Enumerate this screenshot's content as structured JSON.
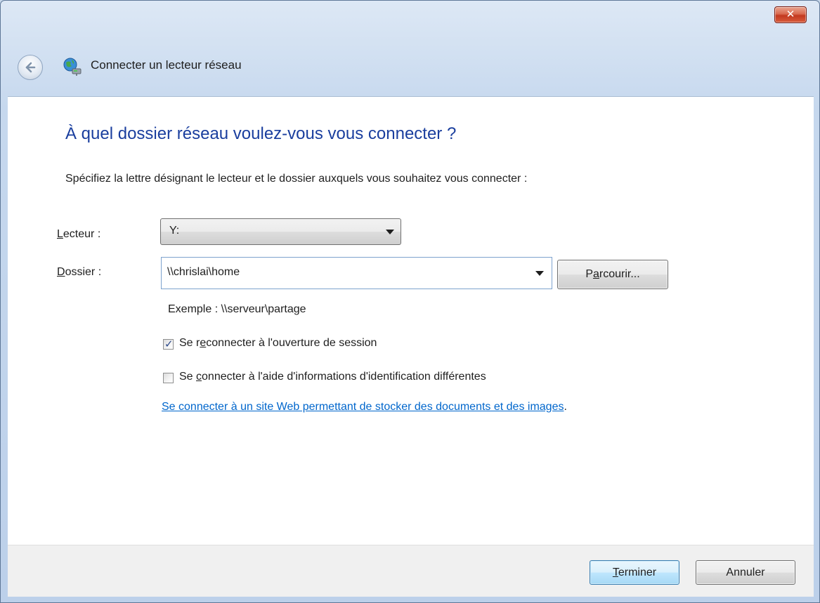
{
  "window": {
    "title": "Connecter un lecteur réseau",
    "close_label": "✕"
  },
  "page": {
    "heading": "À quel dossier réseau voulez-vous vous connecter ?",
    "instruction": "Spécifiez la lettre désignant le lecteur et le dossier auxquels vous souhaitez vous connecter :"
  },
  "form": {
    "drive": {
      "label_mnemonic": "L",
      "label_rest": "ecteur :",
      "value": "Y:"
    },
    "folder": {
      "label_mnemonic": "D",
      "label_rest": "ossier :",
      "value": "\\\\chrislai\\home"
    },
    "browse": {
      "pre": "P",
      "mnemonic": "a",
      "post": "rcourir..."
    },
    "example": "Exemple : \\\\serveur\\partage",
    "reconnect": {
      "checked": true,
      "pre": "Se r",
      "mnemonic": "e",
      "post": "connecter à l'ouverture de session"
    },
    "credentials": {
      "checked": false,
      "pre": "Se ",
      "mnemonic": "c",
      "post": "onnecter à l'aide d'informations d'identification différentes"
    },
    "link_text": "Se connecter à un site Web permettant de stocker des documents et des images",
    "link_suffix": "."
  },
  "footer": {
    "finish": {
      "mnemonic": "T",
      "rest": "erminer"
    },
    "cancel": "Annuler"
  }
}
